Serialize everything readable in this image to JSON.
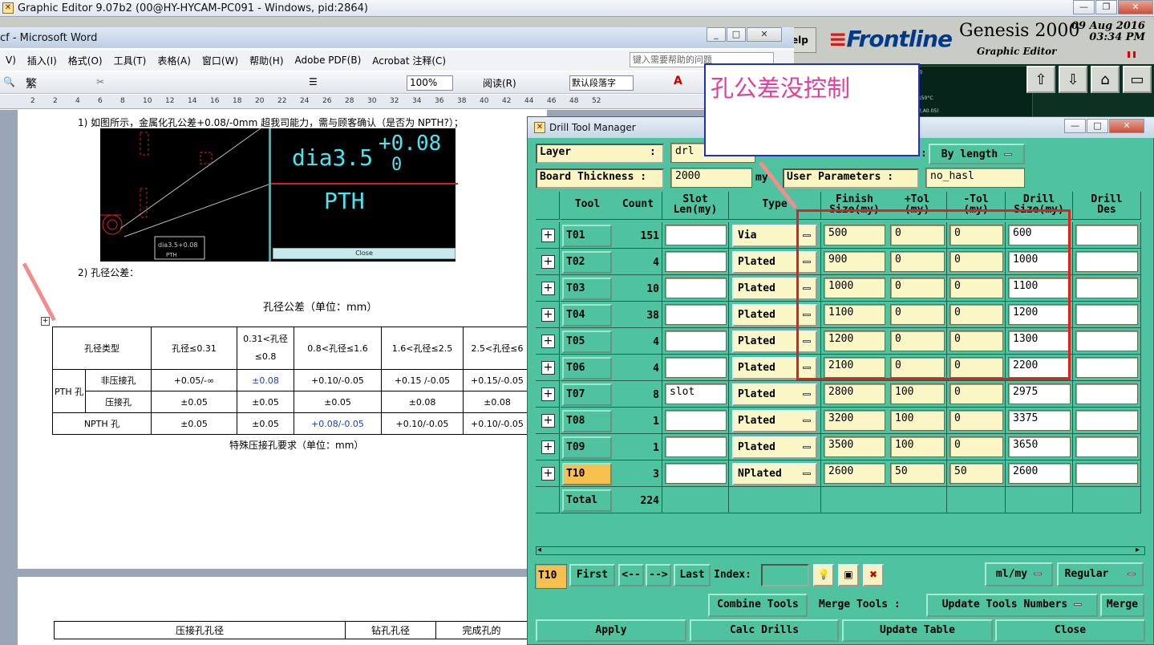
{
  "graphic_editor": {
    "title": "Graphic Editor 9.07b2 (00@HY-HYCAM-PC091 - Windows, pid:2864)"
  },
  "genesis": {
    "brand": "Frontline",
    "product": "Genesis 2000",
    "date": "09 Aug 2016",
    "time": "03:34 PM",
    "subtitle": "Graphic Editor",
    "help": "elp",
    "side_lines": [
      "(Finished)",
      "10%",
      "H,Tg>=150°C",
      "0(E7,N12,A0.05)"
    ]
  },
  "word": {
    "title": "cf - Microsoft Word",
    "menu": [
      "V)",
      "插入(I)",
      "格式(O)",
      "工具(T)",
      "表格(A)",
      "窗口(W)",
      "帮助(H)",
      "Adobe PDF(B)",
      "Acrobat 注释(C)"
    ],
    "help_placeholder": "键入需要帮助的问题",
    "zoom": "100%",
    "read_btn": "阅读(R)",
    "style": "默认段落字",
    "trad": "繁",
    "ruler": [
      "2",
      "2",
      "4",
      "6",
      "8",
      "10",
      "12",
      "14",
      "16",
      "18",
      "20",
      "22",
      "24",
      "26",
      "28",
      "30",
      "32",
      "34",
      "36",
      "38",
      "40",
      "42",
      "44",
      "46",
      "48",
      "52"
    ],
    "item1": "1)  如图所示，金属化孔公差+0.08/-0mm 超我司能力，需与顾客确认（是否为 NPTH?）；",
    "pcb": {
      "dia": "dia3.5",
      "tol_plus": "+0.08",
      "tol_minus": "0",
      "pth": "PTH",
      "close": "Close",
      "small_dia": "dia3.5+0.08",
      "small_pth": "PTH"
    },
    "item2": "2)  孔径公差：",
    "table_title": "孔径公差（单位：mm）",
    "table": {
      "headers": [
        "孔径类型",
        "孔径≤0.31",
        "0.31<孔径",
        "≤0.8",
        "0.8<孔径≤1.6",
        "1.6<孔径≤2.5",
        "2.5<孔径≤6"
      ],
      "pth": "PTH 孔",
      "row1": [
        "非压接孔",
        "+0.05/-∞",
        "±0.08",
        "+0.10/-0.05",
        "+0.15 /-0.05",
        "+0.15/-0.05"
      ],
      "row2": [
        "压接孔",
        "±0.05",
        "±0.05",
        "±0.05",
        "±0.08",
        "±0.08"
      ],
      "row3": [
        "NPTH 孔",
        "±0.05",
        "±0.05",
        "+0.08/-0.05",
        "+0.10/-0.05",
        "+0.10/-0.05"
      ]
    },
    "special_title": "特殊压接孔要求（单位：mm）",
    "table2": [
      "压接孔孔径",
      "钻孔孔径",
      "完成孔的"
    ]
  },
  "dtm": {
    "title": "Drill Tool Manager",
    "layer_label": "Layer",
    "layer_value": "drl",
    "sort_value": "By length",
    "board_label": "Board Thickness :",
    "board_value": "2000",
    "board_unit": "my",
    "user_label": "User Parameters :",
    "user_value": "no_hasl",
    "headers": {
      "tool": "Tool",
      "count": "Count",
      "slot1": "Slot",
      "slot2": "Len(my)",
      "type": "Type",
      "fin1": "Finish",
      "fin2": "Size(my)",
      "pt1": "+Tol",
      "pt2": "(my)",
      "mt1": "-Tol",
      "mt2": "(my)",
      "dr1": "Drill",
      "dr2": "Size(my)",
      "dd1": "Drill",
      "dd2": "Des"
    },
    "rows": [
      {
        "tool": "T01",
        "count": "151",
        "slot": "",
        "type": "Via",
        "finish": "500",
        "ptol": "0",
        "mtol": "0",
        "drill": "600"
      },
      {
        "tool": "T02",
        "count": "4",
        "slot": "",
        "type": "Plated",
        "finish": "900",
        "ptol": "0",
        "mtol": "0",
        "drill": "1000"
      },
      {
        "tool": "T03",
        "count": "10",
        "slot": "",
        "type": "Plated",
        "finish": "1000",
        "ptol": "0",
        "mtol": "0",
        "drill": "1100"
      },
      {
        "tool": "T04",
        "count": "38",
        "slot": "",
        "type": "Plated",
        "finish": "1100",
        "ptol": "0",
        "mtol": "0",
        "drill": "1200"
      },
      {
        "tool": "T05",
        "count": "4",
        "slot": "",
        "type": "Plated",
        "finish": "1200",
        "ptol": "0",
        "mtol": "0",
        "drill": "1300"
      },
      {
        "tool": "T06",
        "count": "4",
        "slot": "",
        "type": "Plated",
        "finish": "2100",
        "ptol": "0",
        "mtol": "0",
        "drill": "2200"
      },
      {
        "tool": "T07",
        "count": "8",
        "slot": "slot",
        "type": "Plated",
        "finish": "2800",
        "ptol": "100",
        "mtol": "0",
        "drill": "2975"
      },
      {
        "tool": "T08",
        "count": "1",
        "slot": "",
        "type": "Plated",
        "finish": "3200",
        "ptol": "100",
        "mtol": "0",
        "drill": "3375"
      },
      {
        "tool": "T09",
        "count": "1",
        "slot": "",
        "type": "Plated",
        "finish": "3500",
        "ptol": "100",
        "mtol": "0",
        "drill": "3650"
      },
      {
        "tool": "T10",
        "count": "3",
        "slot": "",
        "type": "NPlated",
        "finish": "2600",
        "ptol": "50",
        "mtol": "50",
        "drill": "2600"
      }
    ],
    "total_label": "Total",
    "total_count": "224",
    "current_tool": "T10",
    "nav": {
      "first": "First",
      "prev": "<--",
      "next": "-->",
      "last": "Last",
      "index": "Index:"
    },
    "units": "ml/my",
    "mode": "Regular",
    "combine": "Combine Tools",
    "merge_label": "Merge Tools :",
    "update_numbers": "Update Tools Numbers",
    "merge": "Merge",
    "apply": "Apply",
    "calc": "Calc Drills",
    "update_table": "Update Table",
    "close": "Close"
  },
  "annotation": {
    "text": "孔公差没控制"
  },
  "colors": {
    "dtm_bg": "#4fc29f",
    "field": "#fbf6c6",
    "selected": "#f7c04e",
    "annot_text": "#e0409c",
    "highlight": "#e02020"
  }
}
